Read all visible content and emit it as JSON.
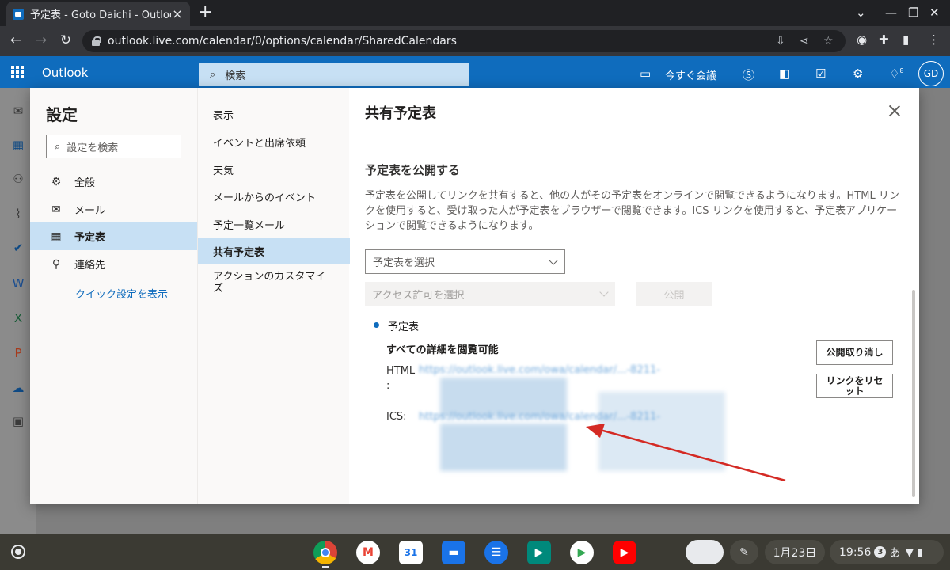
{
  "browser": {
    "tab_title": "予定表 - Goto Daichi - Outlook",
    "url": "outlook.live.com/calendar/0/options/calendar/SharedCalendars"
  },
  "outlook": {
    "brand": "Outlook",
    "search_placeholder": "検索",
    "meet_now": "今すぐ会議",
    "avatar_initials": "GD",
    "notification_count": "8"
  },
  "settings": {
    "title": "設定",
    "search_placeholder": "設定を検索",
    "categories": [
      {
        "label": "全般",
        "icon": "gear-icon"
      },
      {
        "label": "メール",
        "icon": "mail-icon"
      },
      {
        "label": "予定表",
        "icon": "calendar-icon"
      },
      {
        "label": "連絡先",
        "icon": "people-icon"
      }
    ],
    "quick_settings_link": "クイック設定を表示",
    "subcategories": [
      "表示",
      "イベントと出席依頼",
      "天気",
      "メールからのイベント",
      "予定一覧メール",
      "共有予定表",
      "アクションのカスタマイズ"
    ]
  },
  "panel": {
    "title": "共有予定表",
    "section_title": "予定表を公開する",
    "description": "予定表を公開してリンクを共有すると、他の人がその予定表をオンラインで閲覧できるようになります。HTML リンクを使用すると、受け取った人が予定表をブラウザーで閲覧できます。ICS リンクを使用すると、予定表アプリケーションで閲覧できるようになります。",
    "calendar_select": "予定表を選択",
    "permission_select": "アクセス許可を選択",
    "publish_button": "公開",
    "published": {
      "calendar_name": "予定表",
      "permission": "すべての詳細を閲覧可能",
      "html_label": "HTML :",
      "ics_label": "ICS:",
      "html_link": "https://outlook.live.com/owa/calendar/...-8211-",
      "ics_link": "https://outlook.live.com/owa/calendar/...-8211-",
      "unpublish_button": "公開取り消し",
      "reset_link_button": "リンクをリセット"
    }
  },
  "shelf": {
    "date": "1月23日",
    "time": "19:56",
    "notifications": "3",
    "ime": "あ",
    "calendar_day": "31"
  }
}
